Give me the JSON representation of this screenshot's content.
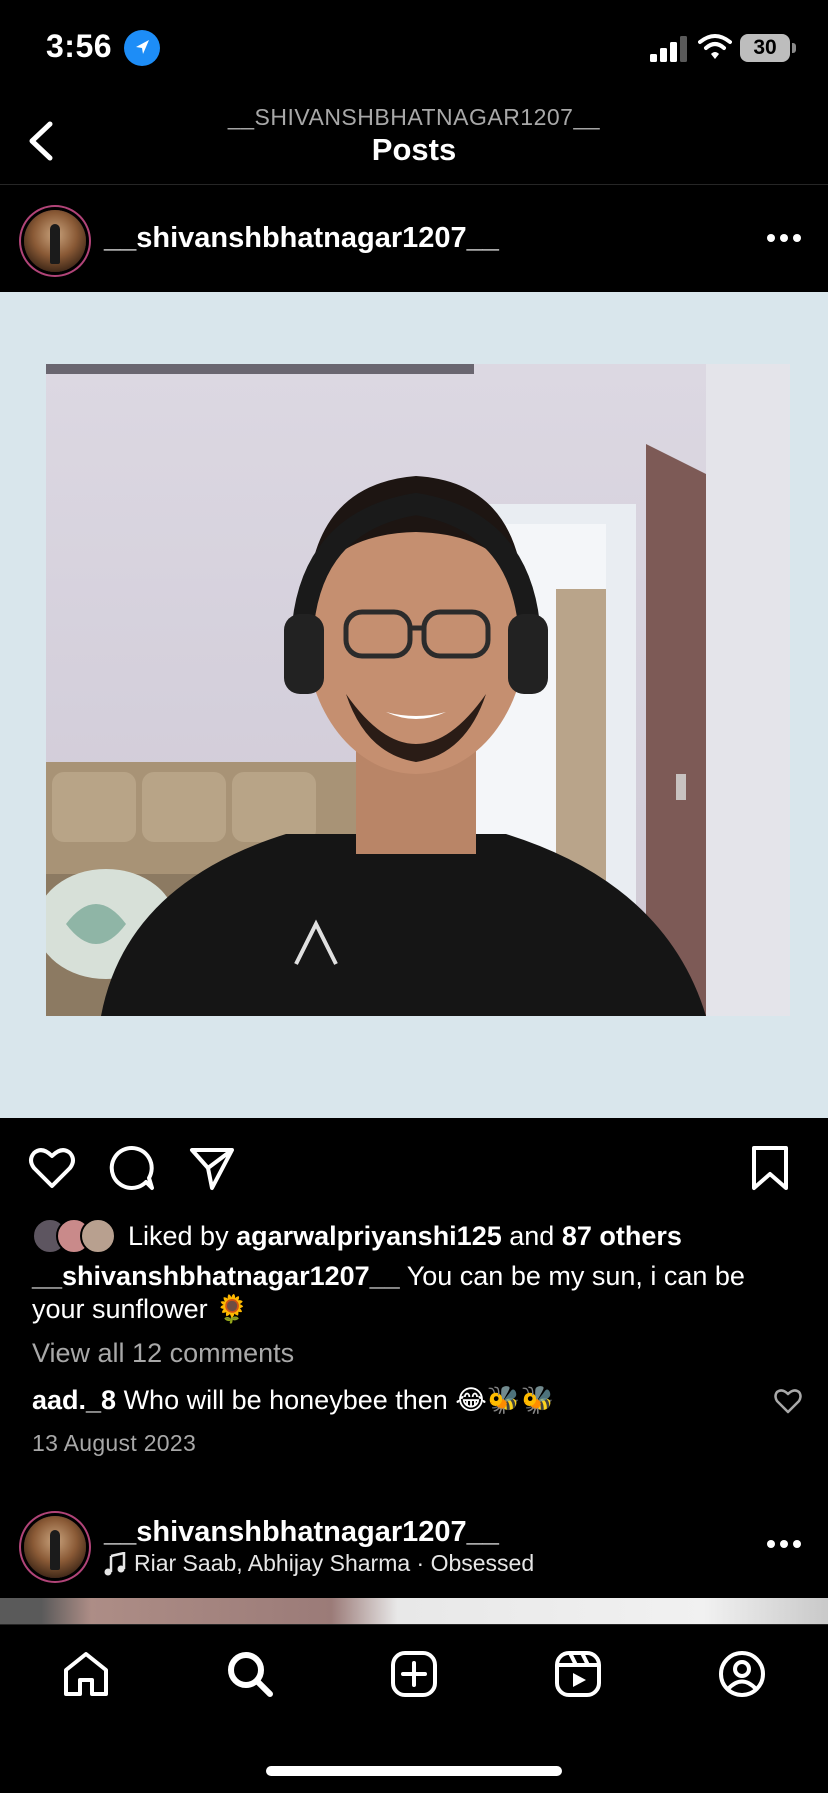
{
  "status_bar": {
    "time": "3:56",
    "battery": "30",
    "icons": [
      "location-arrow-icon",
      "cellular-signal-icon",
      "wifi-icon",
      "battery-icon"
    ]
  },
  "header": {
    "subtitle": "__SHIVANSHBHATNAGAR1207__",
    "title": "Posts",
    "back_icon": "chevron-left-icon"
  },
  "post": {
    "username": "__shivanshbhatnagar1207__",
    "more_icon": "more-horizontal-icon",
    "liked": {
      "prefix": "Liked by",
      "user": "agarwalpriyanshi125",
      "and": "and",
      "others": "87 others"
    },
    "caption": {
      "username": "__shivanshbhatnagar1207__",
      "text": "You can be my sun, i can be your sunflower 🌻"
    },
    "view_comments": "View all 12 comments",
    "comment": {
      "username": "aad._8",
      "text": "Who will be honeybee then 😂🐝🐝"
    },
    "date": "13 August 2023",
    "action_icons": [
      "heart-icon",
      "comment-icon",
      "share-icon",
      "bookmark-icon"
    ]
  },
  "next_post": {
    "username": "__shivanshbhatnagar1207__",
    "music": "Riar Saab, Abhijay Sharma · Obsessed",
    "more_icon": "more-horizontal-icon"
  },
  "bottom_nav": {
    "items": [
      "home-icon",
      "search-icon",
      "create-post-icon",
      "reels-icon",
      "profile-icon"
    ]
  },
  "colors": {
    "background": "#000000",
    "secondary_text": "#a8a8a8",
    "photo_background": "#d9e6ec",
    "location_blue": "#1d8df7"
  }
}
